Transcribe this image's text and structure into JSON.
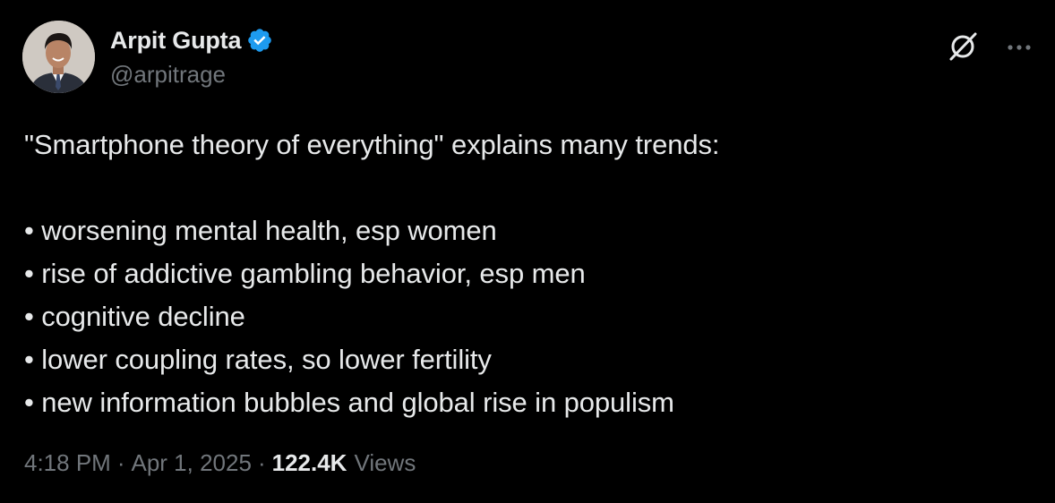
{
  "author": {
    "display_name": "Arpit Gupta",
    "handle": "@arpitrage",
    "verified": true,
    "verified_color": "#1d9bf0"
  },
  "header_icons": {
    "grok": "grok-icon",
    "more": "more-icon"
  },
  "tweet": {
    "intro": "\"Smartphone theory of everything\" explains many trends:",
    "bullets": [
      "• worsening mental health, esp women",
      "• rise of addictive gambling behavior, esp men",
      "• cognitive decline",
      "• lower coupling rates, so lower fertility",
      "• new information bubbles and global rise in populism"
    ]
  },
  "meta": {
    "time": "4:18 PM",
    "separator": "·",
    "date": "Apr 1, 2025",
    "views_count": "122.4K",
    "views_label": "Views"
  }
}
